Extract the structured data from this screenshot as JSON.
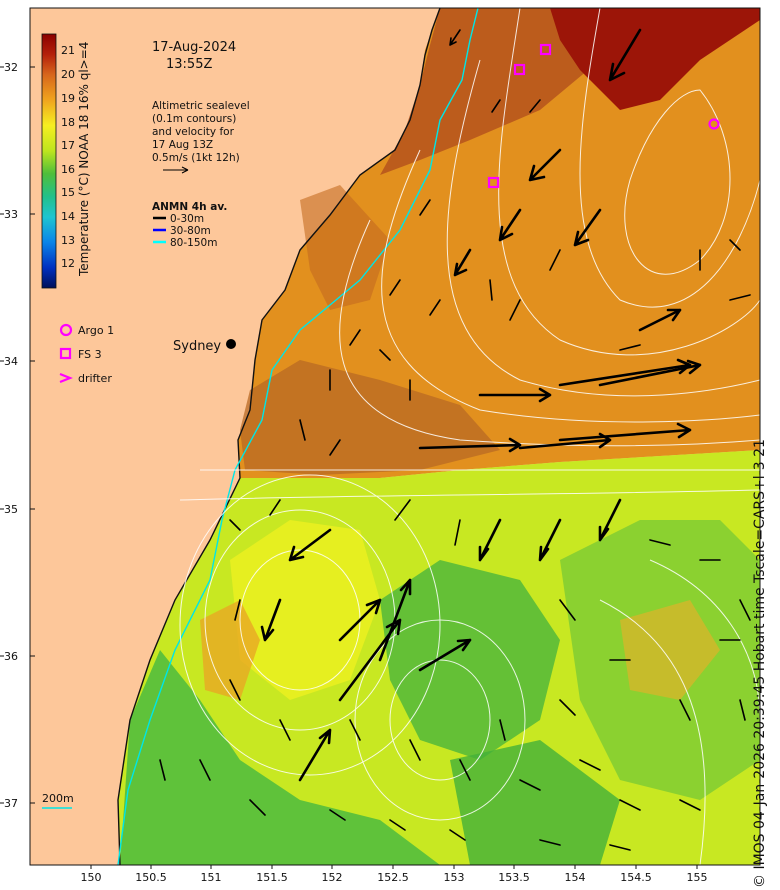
{
  "map": {
    "date": "17-Aug-2024",
    "time": "13:55Z",
    "sealevel_note": [
      "Altimetric sealevel",
      "(0.1m contours)",
      "and velocity for",
      "17 Aug 13Z",
      "0.5m/s (1kt 12h)"
    ],
    "colorbar_title": "Temperature (°C) NOAA 18 16% ql>=4",
    "colorbar_ticks": [
      "21",
      "20",
      "19",
      "18",
      "17",
      "16",
      "15",
      "14",
      "13",
      "12"
    ],
    "anmn": {
      "title": "ANMN 4h av.",
      "items": [
        {
          "label": "0-30m",
          "color": "#000000"
        },
        {
          "label": "30-80m",
          "color": "#0000ff"
        },
        {
          "label": "80-150m",
          "color": "#00ffff"
        }
      ]
    },
    "platforms": [
      {
        "label": "Argo 1",
        "symbol": "circle"
      },
      {
        "label": "FS 3",
        "symbol": "square"
      },
      {
        "label": "drifter",
        "symbol": "chevron"
      }
    ],
    "city": "Sydney",
    "depth_label": "200m",
    "y_ticks": [
      "32",
      "33",
      "34",
      "35",
      "36",
      "37"
    ],
    "x_ticks": [
      "150",
      "150.5",
      "151",
      "151.5",
      "152",
      "152.5",
      "153",
      "153.5",
      "154",
      "154.5",
      "155"
    ],
    "footer": "© IMOS 04-Jan-2026 20:39:45 Hobart time Tscale=CARS+l-3 21",
    "colors": {
      "land": "#fdc79a",
      "warm_dark": "#b5531c",
      "warm": "#e2901e",
      "cool": "#c8e822",
      "green": "#5fc23a",
      "marker": "#ff00ff",
      "isobath": "#00e6e6"
    }
  }
}
